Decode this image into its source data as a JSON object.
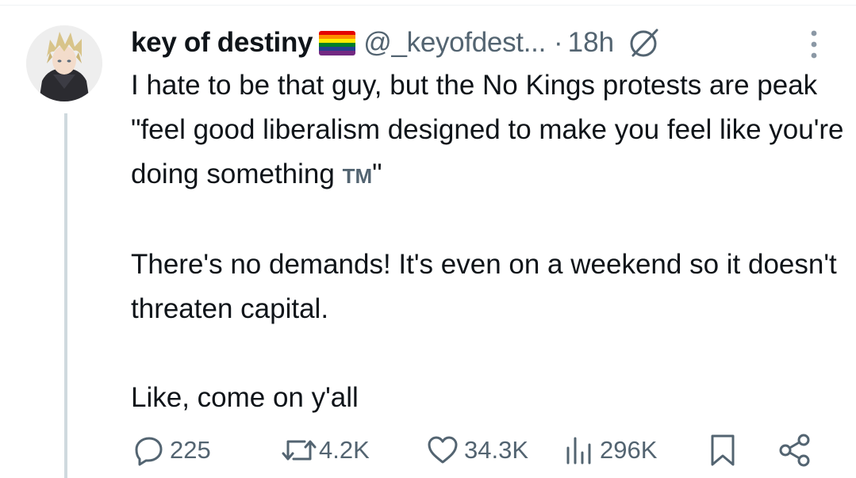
{
  "tweet": {
    "author": {
      "display_name": "key of destiny",
      "flag_icon": "rainbow-flag",
      "handle": "@_keyofdest...",
      "avatar_icon": "anime-avatar"
    },
    "separator": "·",
    "time": "18h",
    "body": {
      "paragraph1_text": "I hate to be that guy, but the No Kings protests are peak \"feel good liberalism designed to make you feel like you're doing something ",
      "paragraph1_tm": "TM",
      "paragraph1_end": "\"",
      "paragraph2": "There's no demands! It's even on a weekend so it doesn't threaten capital.",
      "paragraph3": "Like, come on y'all"
    },
    "stats": {
      "replies": "225",
      "reposts": "4.2K",
      "likes": "34.3K",
      "views": "296K"
    }
  },
  "colors": {
    "text": "#0f1419",
    "muted": "#536471",
    "thread_line": "#cfd9de",
    "divider": "#eff3f4"
  }
}
